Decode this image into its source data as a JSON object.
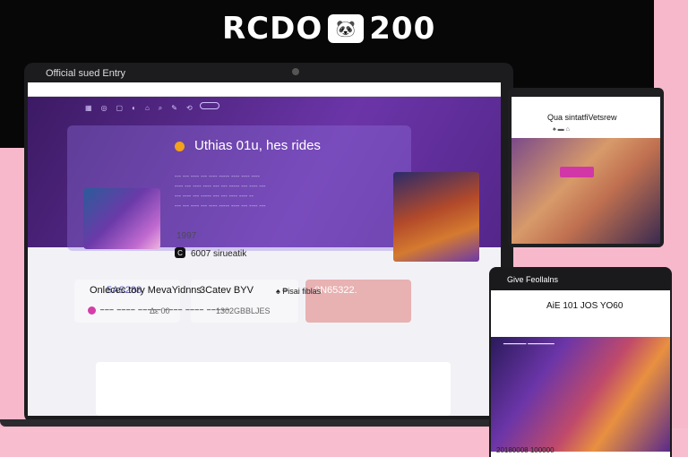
{
  "brand": {
    "title": "RCDO",
    "badge": "🐼",
    "year": "200"
  },
  "laptop": {
    "window_title": "Official sued Entry",
    "nav": [
      "▦",
      "◎",
      "▢",
      "◐",
      "⌂",
      "⌕",
      "✎",
      "⟲"
    ],
    "hero_title": "Uthias 01u, hes rides",
    "hero_lines": [
      "--- --- ---- --- ---- ----- ---- ---- ----",
      "---- --- ---- ---- --- --- ----- --- ---- ---",
      "--- ---- --- ----- --- --- ---- ---- --",
      "--- --- ---- --- ---- ----- ---- --- ---- ---"
    ],
    "stat1": "1997",
    "stat2_icon": "C",
    "stat2": "6007 sirueatik",
    "metrics": [
      {
        "label": "5AS288",
        "sub": "Δε 00"
      },
      {
        "label": "3Catev BYV",
        "sub": "1302GBBLJES"
      },
      {
        "label": "0N65322."
      }
    ],
    "panel_title": "Onlecec tory MevaYidnns",
    "panel_right": "♠ ₱isai fiblas",
    "panel_row": "━━━ ━━━━ ━━━━━ ━━━━ ━━━━ ━━━━━"
  },
  "tablet": {
    "title": "Qua sintatfiVetsrew",
    "meta": "♠  ▬  ⌂"
  },
  "phone": {
    "header": "Give Feollalns",
    "title": "AiE 101 JOS YO60",
    "hero_bar": "━━━━━━  ━━━━━━━",
    "footer": "20180008 100000"
  }
}
